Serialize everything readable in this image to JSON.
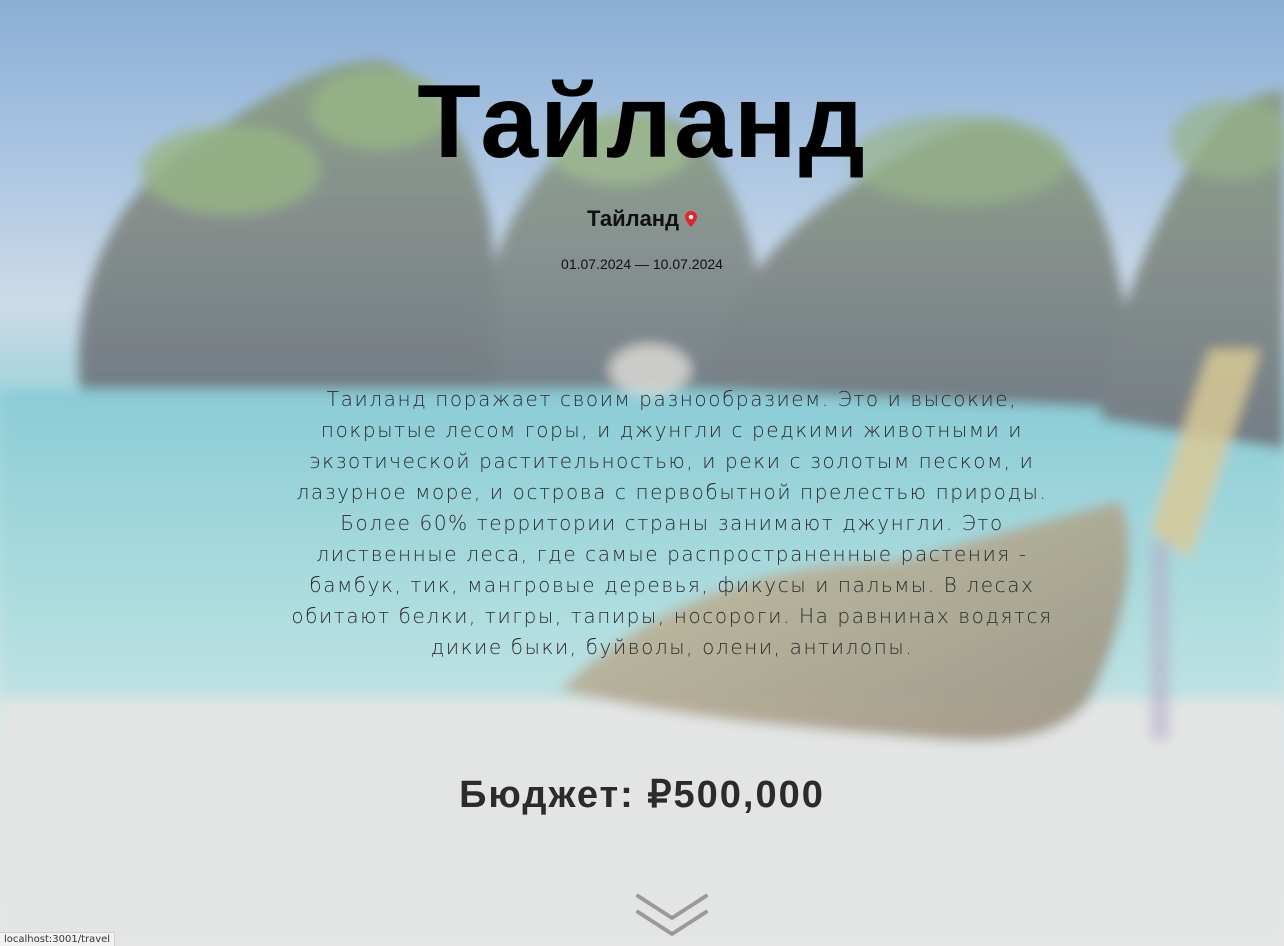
{
  "trip": {
    "title": "Тайланд",
    "location": "Тайланд",
    "dates": "01.07.2024 — 10.07.2024",
    "description": "Таиланд поражает своим разнообразием. Это и высокие, покрытые лесом горы, и джунгли с редкими животными и экзотической растительностью, и реки с золотым песком, и лазурное море, и острова с первобытной прелестью природы. Более 60% территории страны занимают джунгли. Это лиственные леса, где самые распространенные растения - бамбук, тик, мангровые деревья, фикусы и пальмы. В лесах обитают белки, тигры, тапиры, носороги. На равнинах водятся дикие быки, буйволы, олени, антилопы.",
    "budget": "Бюджет: ₽500,000"
  },
  "icons": {
    "location": "map-pin-icon",
    "scroll": "chevron-double-down-icon"
  },
  "colors": {
    "pin": "#e0242c",
    "title": "#000000",
    "body_text": "#2b2b2b"
  },
  "status_bar": {
    "url": "localhost:3001/travel"
  }
}
